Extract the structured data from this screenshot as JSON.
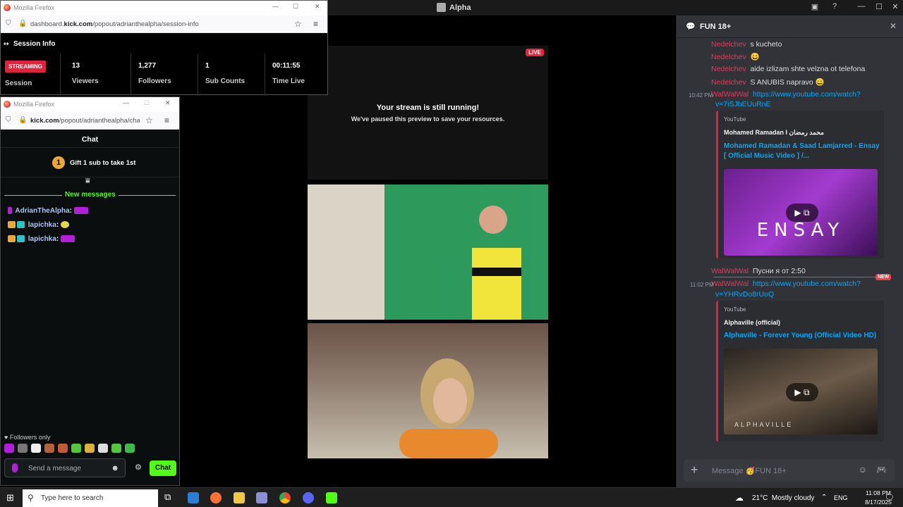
{
  "main_window": {
    "title": "Alpha"
  },
  "stream": {
    "live_badge": "LIVE",
    "heading": "Your stream is still running!",
    "subheading": "We've paused this preview to save your resources."
  },
  "discord": {
    "channel": "FUN 18+",
    "messages": [
      {
        "user": "Nedelchev",
        "text": "s kucheto"
      },
      {
        "user": "Nedelchev",
        "text": "😄"
      },
      {
        "user": "Nedelchev",
        "text": "aide izlizam shte velzna ot telefona"
      },
      {
        "user": "Nedelchev",
        "text": "S ANUBIS napravo 😄"
      }
    ],
    "msg_yt1": {
      "time": "10:42 PM",
      "user": "WalWalWal",
      "link_line1": "https://www.youtube.com/watch?",
      "link_line2": "v=7iSJbEUuRnE"
    },
    "embed1": {
      "source": "YouTube",
      "author": "Mohamed Ramadan I محمد رمضان",
      "title_line1": "Mohamed Ramadan & Saad Lamjarred - Ensay",
      "title_line2": "[ Official Music Video ] /...",
      "thumb_text": "ENSAY"
    },
    "msg_psni": {
      "user": "WalWalWal",
      "text": "Пусни я от 2:50"
    },
    "new_badge": "NEW",
    "msg_yt2": {
      "time": "11:02 PM",
      "user": "WalWalWal",
      "link_line1": "https://www.youtube.com/watch?",
      "link_line2": "v=YHRvDo8rUoQ"
    },
    "embed2": {
      "source": "YouTube",
      "author": "Alphaville (official)",
      "title": "Alphaville - Forever Young (Official Video HD)",
      "thumb_text": "ALPHAVILLE"
    },
    "input_placeholder": "Message 🥳FUN 18+"
  },
  "session_popup": {
    "browser": "Mozilla Firefox",
    "url_pre": "dashboard.",
    "url_domain": "kick.com",
    "url_path": "/popout/adrianthealpha/session-info",
    "header": "Session Info",
    "status_badge": "STREAMING",
    "status_label": "Session",
    "stats": [
      {
        "value": "13",
        "label": "Viewers"
      },
      {
        "value": "1,277",
        "label": "Followers"
      },
      {
        "value": "1",
        "label": "Sub Counts"
      },
      {
        "value": "00:11:55",
        "label": "Time Live"
      }
    ]
  },
  "chat_popup": {
    "browser": "Mozilla Firefox",
    "url_domain": "kick.com",
    "url_path": "/popout/adrianthealpha/chat",
    "header": "Chat",
    "gift_number": "1",
    "gift_text": "Gift 1 sub to take 1st",
    "new_messages": "New messages",
    "messages": [
      {
        "user": "AdrianTheAlpha"
      },
      {
        "user": "lapichka"
      },
      {
        "user": "lapichka"
      }
    ],
    "followers_only": "Followers only",
    "send_placeholder": "Send a message",
    "chat_button": "Chat"
  },
  "taskbar": {
    "search_placeholder": "Type here to search",
    "weather": "21°C  Mostly cloudy",
    "lang": "ENG",
    "time": "11:08 PM",
    "date": "8/17/2025"
  }
}
